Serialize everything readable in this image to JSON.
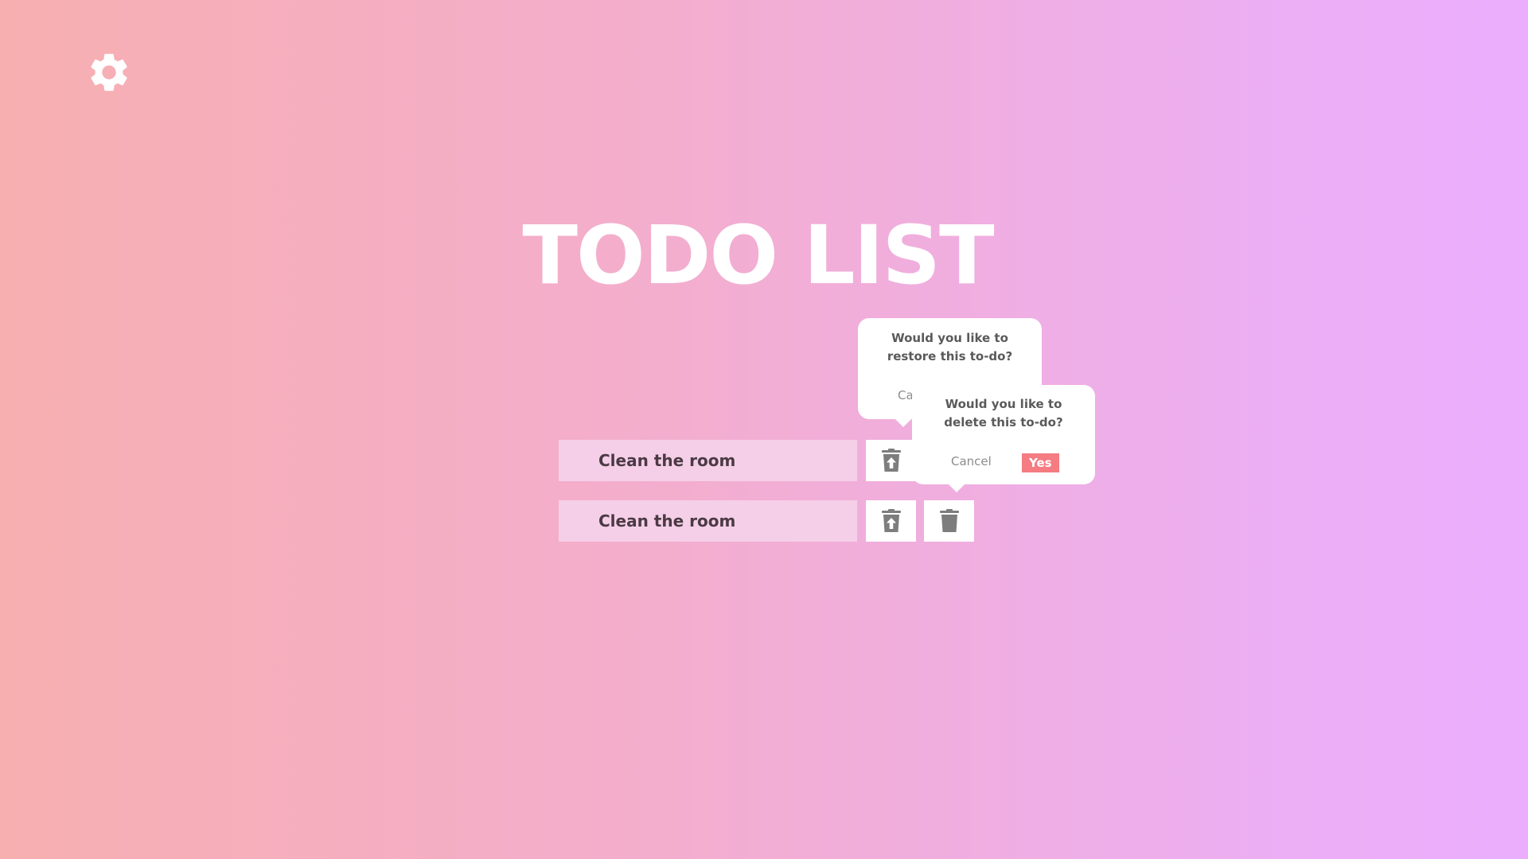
{
  "app": {
    "title": "TODO LIST",
    "settings_icon": "gear-icon"
  },
  "colors": {
    "background_start": "#f7afb0",
    "background_end": "#ebaefd",
    "todo_background": "#f5cfe8",
    "accent_yes": "#f47c82"
  },
  "todos": [
    {
      "text": "Clean the room",
      "restore_icon": "restore-trash-icon",
      "delete_icon": "trash-icon"
    },
    {
      "text": "Clean the room",
      "restore_icon": "restore-trash-icon",
      "delete_icon": "trash-icon"
    }
  ],
  "restore_popover": {
    "question": "Would you like to restore this to-do?",
    "cancel_label": "Cancel"
  },
  "delete_popover": {
    "question": "Would you like to delete this to-do?",
    "cancel_label": "Cancel",
    "yes_label": "Yes"
  }
}
